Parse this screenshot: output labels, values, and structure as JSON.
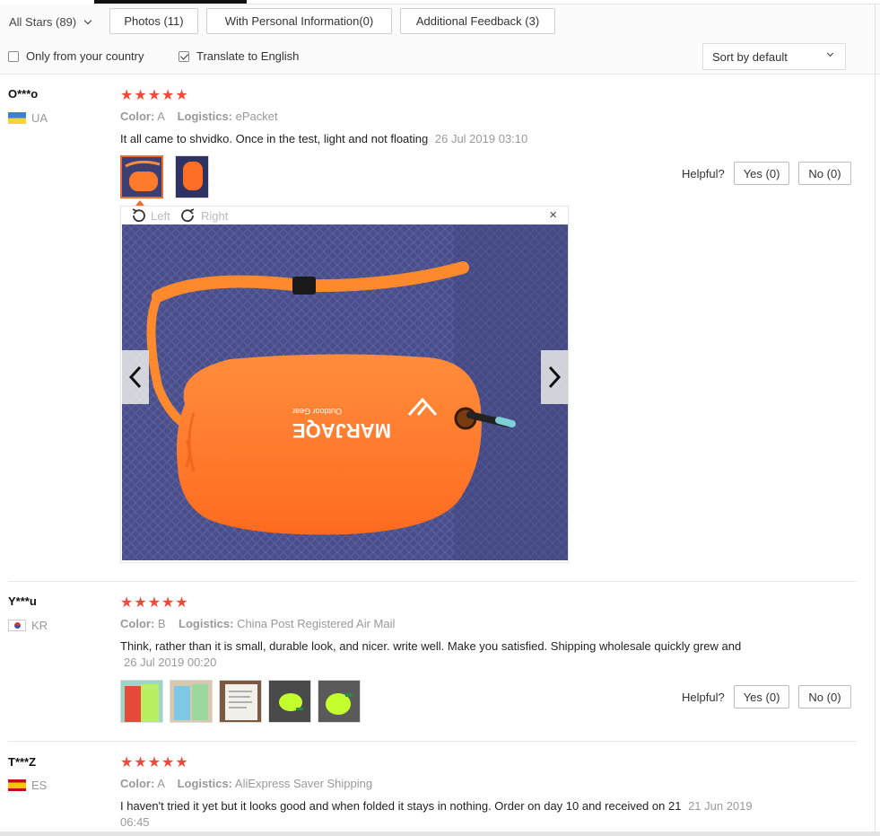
{
  "filters": {
    "all_stars": "All Stars (89)",
    "buttons": [
      "Photos (11)",
      "With Personal Information(0)",
      "Additional Feedback (3)"
    ],
    "only_country": "Only from your country",
    "translate": "Translate to English",
    "sort": "Sort by default"
  },
  "reviews": [
    {
      "user": "O***o",
      "country": "UA",
      "stars": "★★★★★",
      "color_label": "Color:",
      "color": "A",
      "logistics_label": "Logistics:",
      "logistics": "ePacket",
      "text": "It all came to shvidko. Once in the test, light and not floating",
      "date": "26 Jul 2019 03:10",
      "helpful": "Helpful?",
      "yes": "Yes (0)",
      "no": "No (0)"
    },
    {
      "user": "Y***u",
      "country": "KR",
      "stars": "★★★★★",
      "color_label": "Color:",
      "color": "B",
      "logistics_label": "Logistics:",
      "logistics": "China Post Registered Air Mail",
      "text": "Think, rather than it is small, durable look, and nicer. write well. Make you satisfied. Shipping wholesale quickly grew and",
      "date": "26 Jul 2019 00:20",
      "helpful": "Helpful?",
      "yes": "Yes (0)",
      "no": "No (0)"
    },
    {
      "user": "T***Z",
      "country": "ES",
      "stars": "★★★★★",
      "color_label": "Color:",
      "color": "A",
      "logistics_label": "Logistics:",
      "logistics": "AliExpress Saver Shipping",
      "text": "I haven't tried it yet but it looks good and when folded it stays in nothing. Order on day 10 and received on 21",
      "date": "21 Jun 2019 06:45"
    }
  ],
  "viewer": {
    "rotate_left": "Left",
    "rotate_right": "Right",
    "close": "×",
    "brand": "MARJAQE",
    "brand_sub": "Outdoor Gear"
  },
  "colors": {
    "star": "#f04a3b",
    "active_thumb": "#f06c2a",
    "float_orange": "#ff7a2a",
    "fabric": "#4a4f8a"
  }
}
